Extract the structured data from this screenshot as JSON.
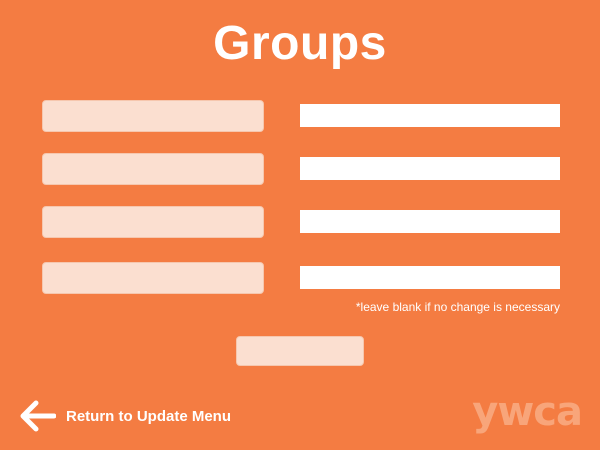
{
  "page": {
    "title": "Groups",
    "background_color": "#f47c42",
    "accent_light": "#fbdfd0"
  },
  "groups": [
    {
      "label": "",
      "value": ""
    },
    {
      "label": "",
      "value": ""
    },
    {
      "label": "",
      "value": ""
    },
    {
      "label": "",
      "value": ""
    }
  ],
  "note": "*leave blank if no change is necessary",
  "submit": {
    "label": ""
  },
  "back": {
    "label": "Return to Update Menu",
    "icon": "arrow-left-icon"
  },
  "logo": {
    "text": "ywca"
  }
}
